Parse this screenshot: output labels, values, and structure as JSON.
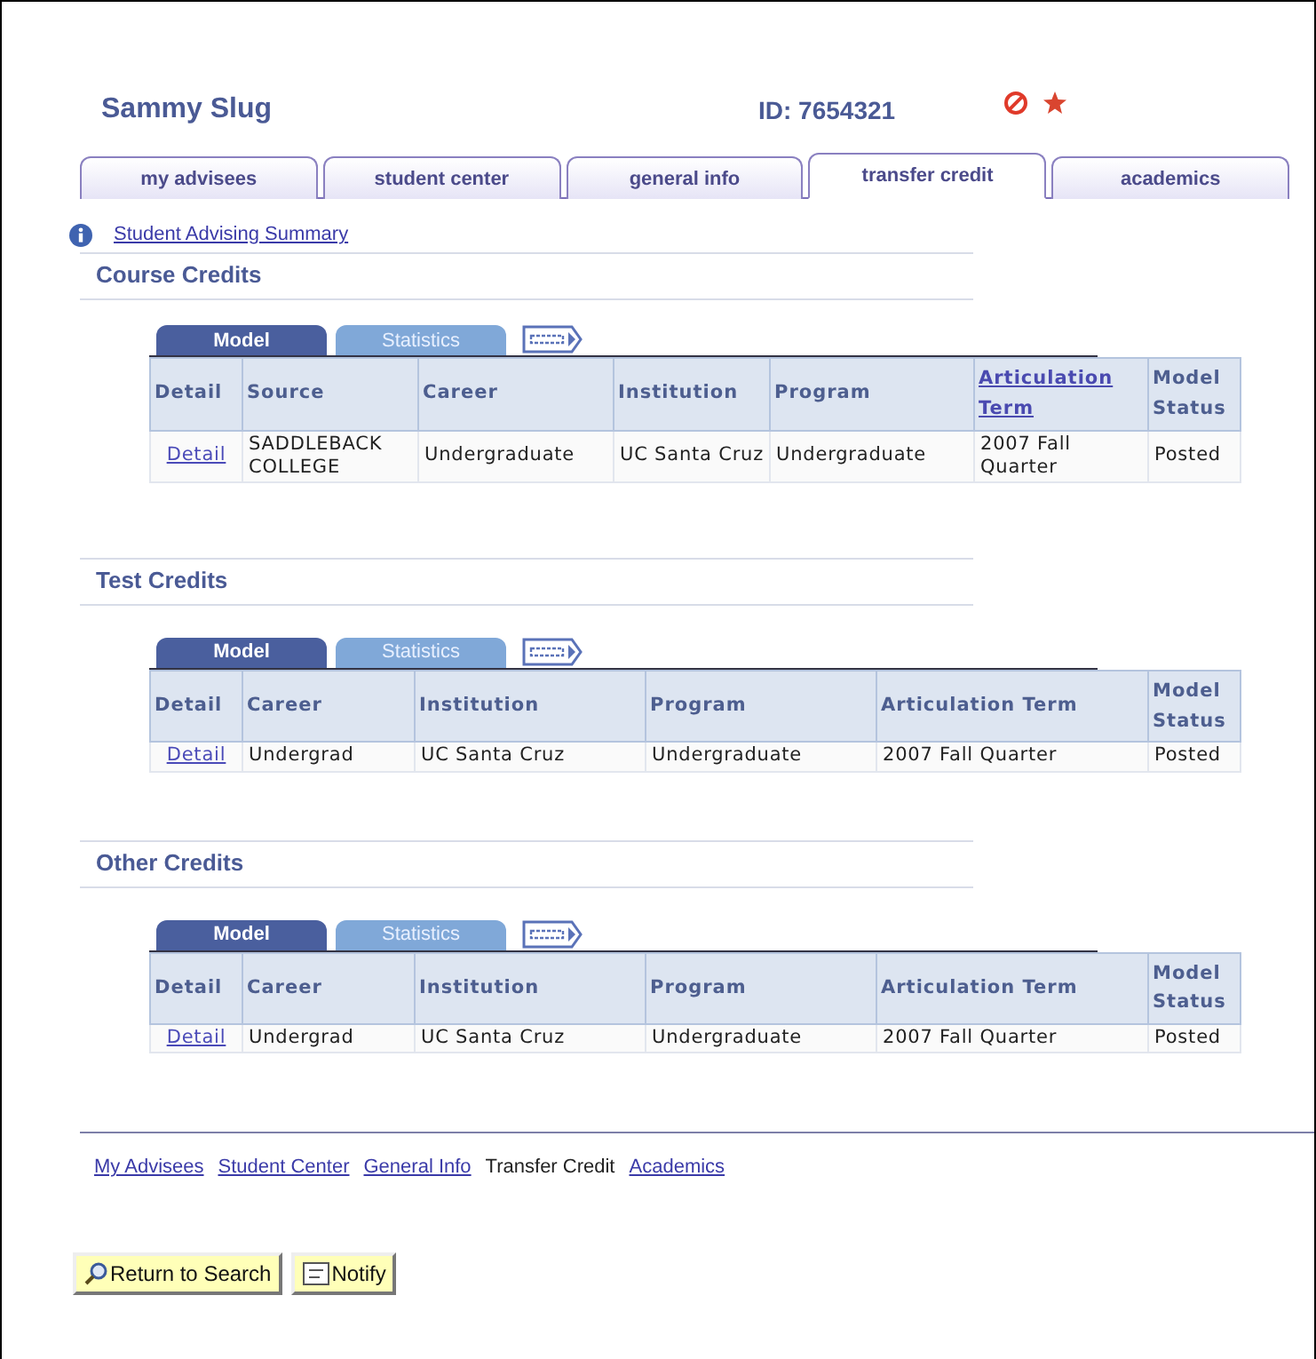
{
  "header": {
    "name": "Sammy Slug",
    "id": "ID: 7654321"
  },
  "tabs": [
    {
      "label": "my advisees",
      "selected": false
    },
    {
      "label": "student center",
      "selected": false
    },
    {
      "label": "general info",
      "selected": false
    },
    {
      "label": "transfer credit",
      "selected": true
    },
    {
      "label": "academics",
      "selected": false
    }
  ],
  "summary_link": "Student Advising Summary",
  "sections": [
    {
      "title": "Course Credits",
      "grid_tabs": [
        {
          "label": "Model",
          "selected": true
        },
        {
          "label": "Statistics",
          "selected": false
        }
      ],
      "columns": [
        {
          "label": "Detail",
          "sortable": false
        },
        {
          "label": "Source",
          "sortable": false
        },
        {
          "label": "Career",
          "sortable": false
        },
        {
          "label": "Institution",
          "sortable": false
        },
        {
          "label": "Program",
          "sortable": false
        },
        {
          "label": "Articulation Term",
          "sortable": true
        },
        {
          "label": "Model Status",
          "sortable": false
        }
      ],
      "rows": [
        [
          {
            "text": "Detail",
            "kind": "link"
          },
          {
            "text": "SADDLEBACK COLLEGE",
            "kind": "text"
          },
          {
            "text": "Undergraduate",
            "kind": "text"
          },
          {
            "text": "UC Santa Cruz",
            "kind": "text"
          },
          {
            "text": "Undergraduate",
            "kind": "text"
          },
          {
            "text": "2007 Fall Quarter",
            "kind": "text"
          },
          {
            "text": "Posted",
            "kind": "text"
          }
        ]
      ]
    },
    {
      "title": "Test Credits",
      "grid_tabs": [
        {
          "label": "Model",
          "selected": true
        },
        {
          "label": "Statistics",
          "selected": false
        }
      ],
      "columns": [
        {
          "label": "Detail",
          "sortable": false
        },
        {
          "label": "Career",
          "sortable": false
        },
        {
          "label": "Institution",
          "sortable": false
        },
        {
          "label": "Program",
          "sortable": false
        },
        {
          "label": "Articulation Term",
          "sortable": false
        },
        {
          "label": "Model Status",
          "sortable": false
        }
      ],
      "rows": [
        [
          {
            "text": "Detail",
            "kind": "link"
          },
          {
            "text": "Undergrad",
            "kind": "text"
          },
          {
            "text": "UC Santa Cruz",
            "kind": "text"
          },
          {
            "text": "Undergraduate",
            "kind": "text"
          },
          {
            "text": "2007 Fall Quarter",
            "kind": "text"
          },
          {
            "text": "Posted",
            "kind": "text"
          }
        ]
      ]
    },
    {
      "title": "Other Credits",
      "grid_tabs": [
        {
          "label": "Model",
          "selected": true
        },
        {
          "label": "Statistics",
          "selected": false
        }
      ],
      "columns": [
        {
          "label": "Detail",
          "sortable": false
        },
        {
          "label": "Career",
          "sortable": false
        },
        {
          "label": "Institution",
          "sortable": false
        },
        {
          "label": "Program",
          "sortable": false
        },
        {
          "label": "Articulation Term",
          "sortable": false
        },
        {
          "label": "Model Status",
          "sortable": false
        }
      ],
      "rows": [
        [
          {
            "text": "Detail",
            "kind": "link"
          },
          {
            "text": "Undergrad",
            "kind": "text"
          },
          {
            "text": "UC Santa Cruz",
            "kind": "text"
          },
          {
            "text": "Undergraduate",
            "kind": "text"
          },
          {
            "text": "2007 Fall Quarter",
            "kind": "text"
          },
          {
            "text": "Posted",
            "kind": "text"
          }
        ]
      ]
    }
  ],
  "page_links": [
    {
      "label": "My Advisees",
      "current": false
    },
    {
      "label": "Student Center",
      "current": false
    },
    {
      "label": "General Info",
      "current": false
    },
    {
      "label": "Transfer Credit",
      "current": true
    },
    {
      "label": "Academics",
      "current": false
    }
  ],
  "buttons": [
    {
      "label": "Return to Search",
      "kind": "search"
    },
    {
      "label": "Notify",
      "kind": "notify"
    }
  ]
}
